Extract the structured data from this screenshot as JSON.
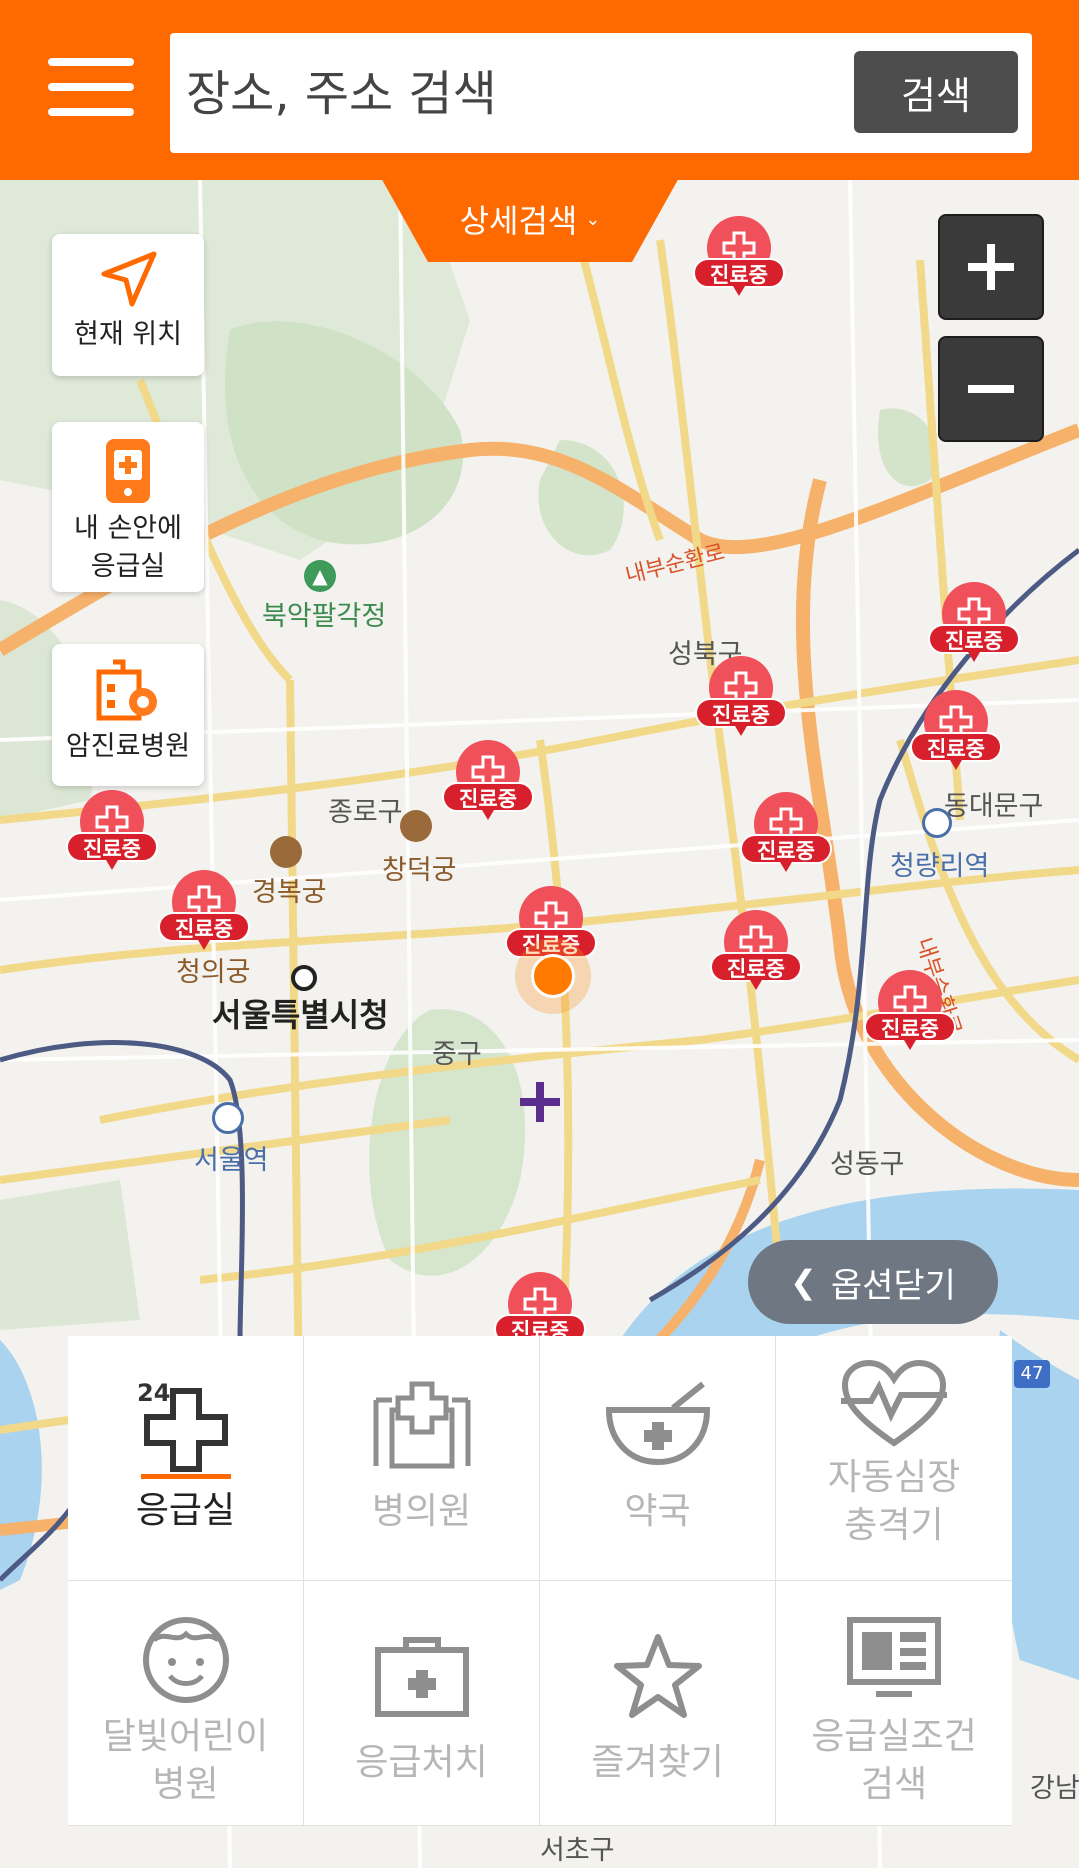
{
  "header": {
    "search_placeholder": "장소, 주소 검색",
    "search_button": "검색",
    "detail_search": "상세검색",
    "accent_color": "#ff6a00"
  },
  "side_buttons": {
    "current_location": "현재 위치",
    "er_in_hand_line1": "내 손안에",
    "er_in_hand_line2": "응급실",
    "cancer_hospital": "암진료병원"
  },
  "map": {
    "labels": {
      "bukak": "북악팔각정",
      "seongbuk": "성북구",
      "jongno": "종로구",
      "changdeok": "창덕궁",
      "gyeongbok": "경복궁",
      "dongdaemun": "동대문구",
      "cheongnyangni": "청량리역",
      "city_hall": "서울특별시청",
      "junggu": "중구",
      "seoul_station": "서울역",
      "seongdong": "성동구",
      "seocho": "서초구",
      "gangnam": "강남",
      "sajik": "청의궁",
      "inner_ring_1": "내부순환로",
      "inner_ring_2": "내부순환로",
      "highway_47": "47"
    },
    "pin_label": "진료중",
    "option_close": "옵션닫기"
  },
  "panel": {
    "items": [
      {
        "label": "응급실",
        "icon": "emergency-24-icon"
      },
      {
        "label": "병의원",
        "icon": "hospital-icon"
      },
      {
        "label": "약국",
        "icon": "pharmacy-icon"
      },
      {
        "label": "자동심장\n충격기",
        "icon": "heart-defibrillator-icon"
      },
      {
        "label": "달빛어린이\n병원",
        "icon": "child-face-icon"
      },
      {
        "label": "응급처치",
        "icon": "first-aid-kit-icon"
      },
      {
        "label": "즐겨찾기",
        "icon": "star-icon"
      },
      {
        "label": "응급실조건\n검색",
        "icon": "monitor-icon"
      }
    ],
    "badge_24": "24"
  }
}
